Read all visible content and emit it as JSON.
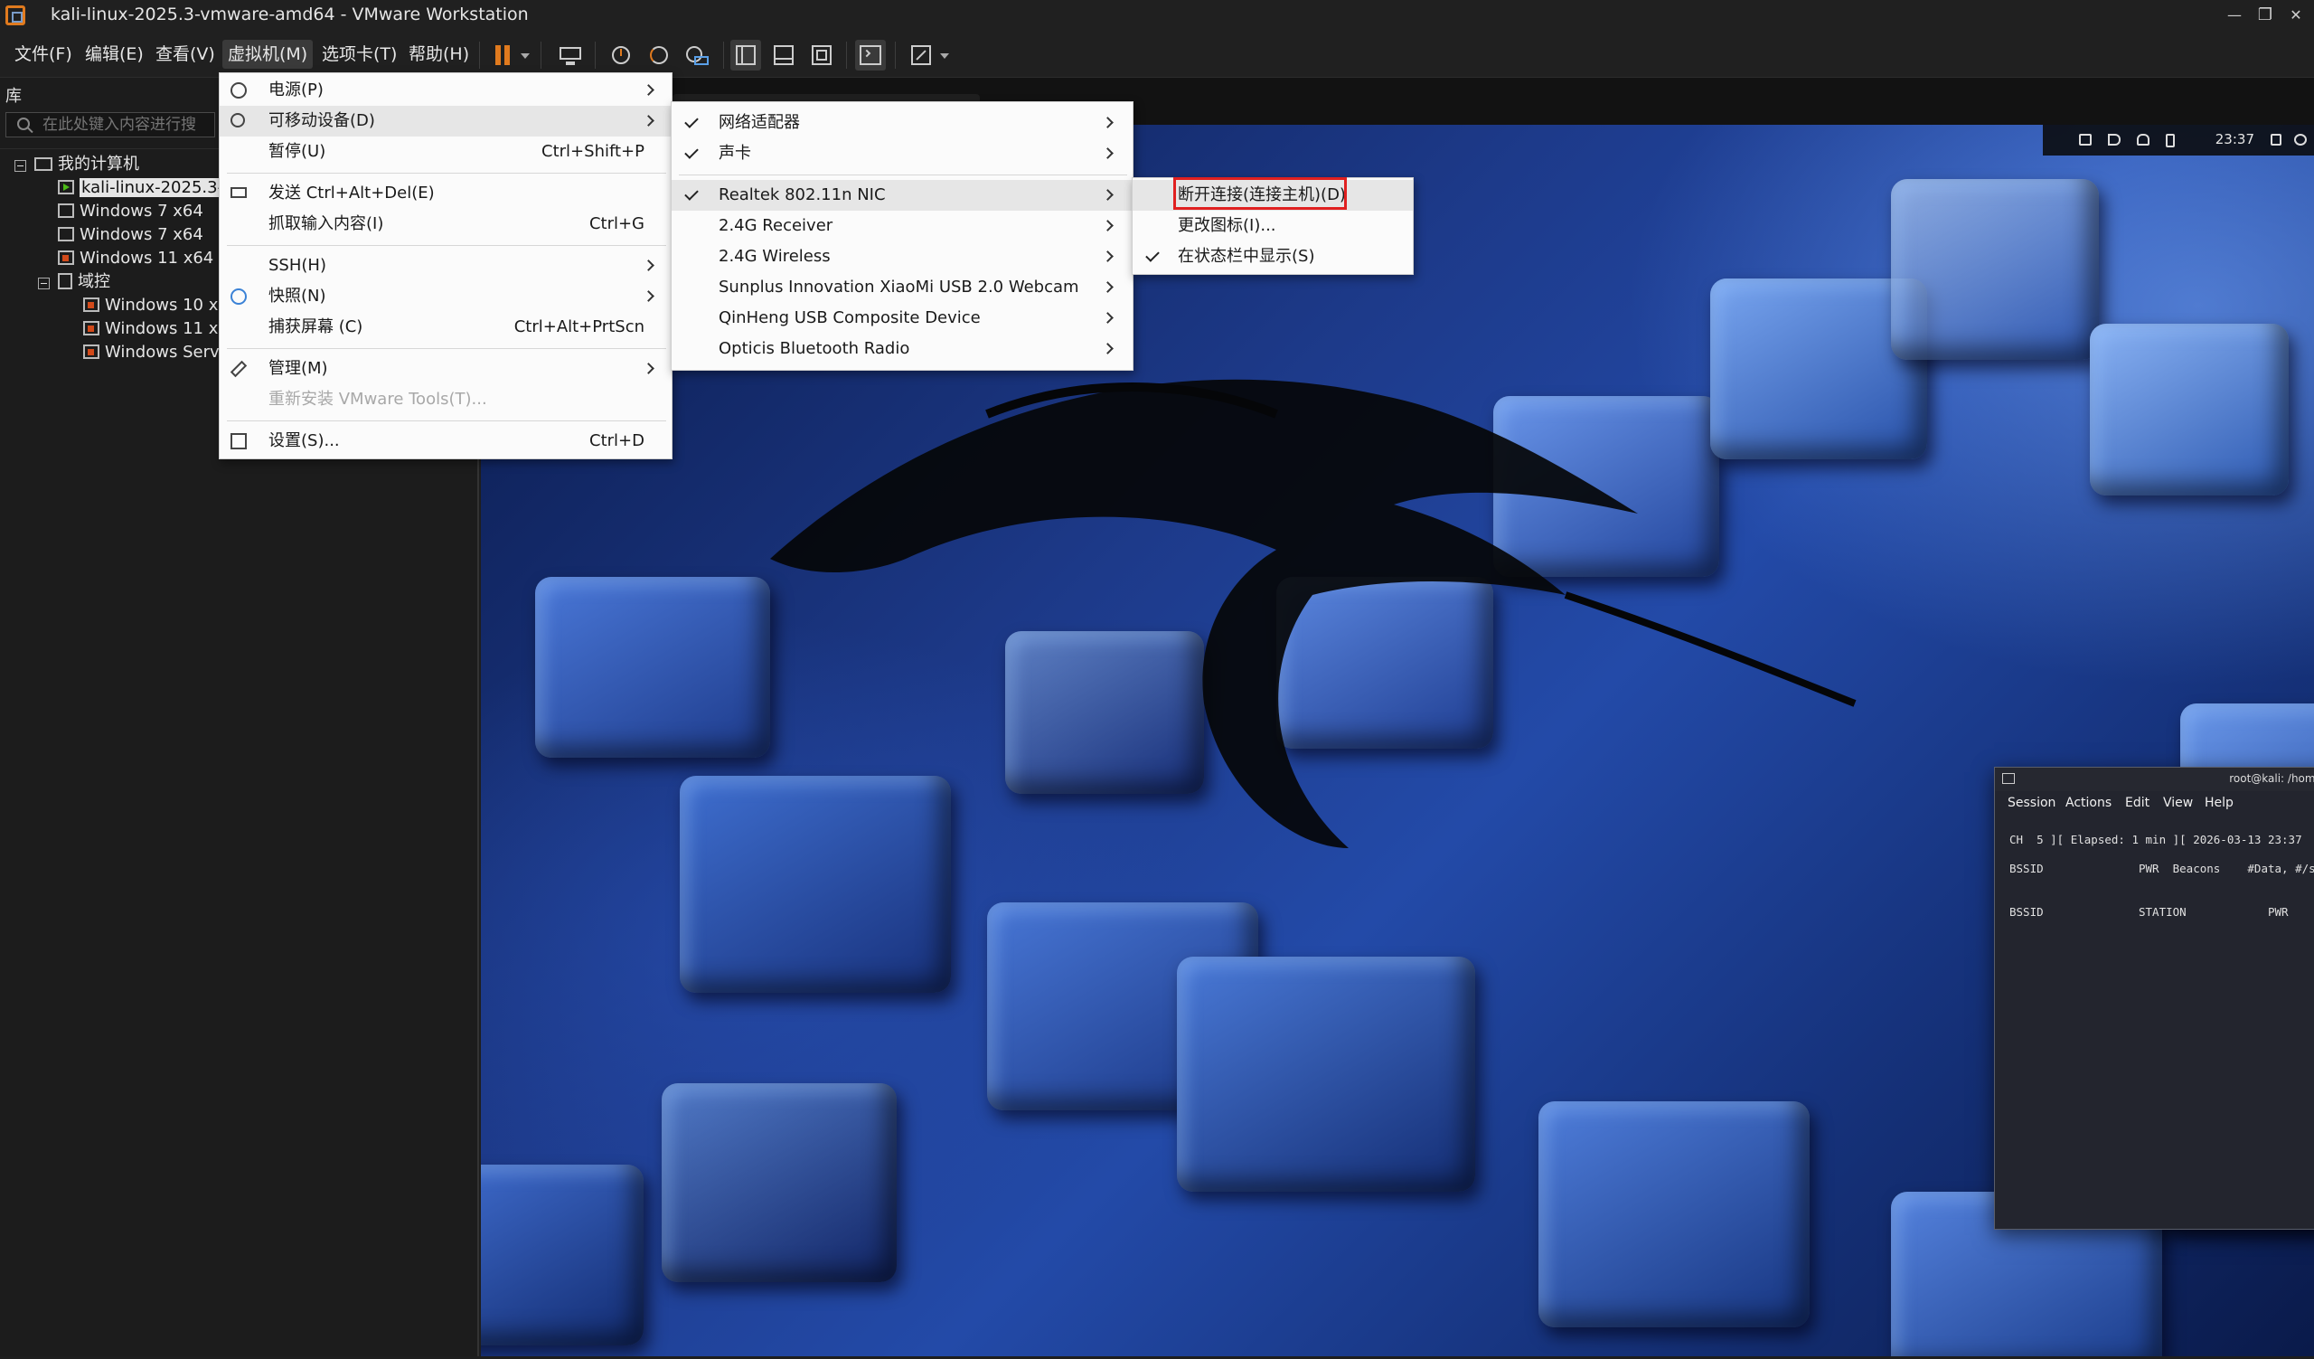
{
  "window": {
    "title": "kali-linux-2025.3-vmware-amd64 - VMware Workstation",
    "min_label": "—",
    "restore_label": "❐",
    "close_label": "✕"
  },
  "menubar": {
    "items": [
      {
        "label": "文件(F)"
      },
      {
        "label": "编辑(E)"
      },
      {
        "label": "查看(V)"
      },
      {
        "label": "虚拟机(M)"
      },
      {
        "label": "选项卡(T)"
      },
      {
        "label": "帮助(H)"
      }
    ]
  },
  "toolbar": {
    "icons": [
      "pause-icon",
      "dropdown-icon",
      "send-ctrl-alt-del-icon",
      "snapshot-icon",
      "revert-snapshot-icon",
      "snapshot-manager-icon",
      "show-library-icon",
      "thumbnail-bar-icon",
      "fullscreen-icon",
      "console-view-icon",
      "stretch-icon",
      "stretch-dropdown-icon"
    ],
    "accent": "#e07a1e"
  },
  "library": {
    "title": "库",
    "search_placeholder": "在此处键入内容进行搜",
    "tree": [
      {
        "label": "我的计算机",
        "type": "computer"
      },
      {
        "label": "kali-linux-2025.3-",
        "type": "vm-running",
        "selected": true
      },
      {
        "label": "Windows 7 x64",
        "type": "vm"
      },
      {
        "label": "Windows 7 x64",
        "type": "vm"
      },
      {
        "label": "Windows 11 x64",
        "type": "vm-locked"
      },
      {
        "label": "域控",
        "type": "folder"
      },
      {
        "label": "Windows 10 x",
        "type": "vm-locked"
      },
      {
        "label": "Windows 11 x",
        "type": "vm-locked"
      },
      {
        "label": "Windows Serv",
        "type": "vm-locked"
      }
    ]
  },
  "vm_menu": {
    "items": [
      {
        "label": "电源(P)",
        "icon": "power-icon",
        "submenu": true
      },
      {
        "label": "可移动设备(D)",
        "icon": "removable-device-icon",
        "submenu": true,
        "highlighted": true
      },
      {
        "label": "暂停(U)",
        "shortcut": "Ctrl+Shift+P"
      },
      {
        "label": "发送 Ctrl+Alt+Del(E)",
        "icon": "keyboard-icon"
      },
      {
        "label": "抓取输入内容(I)",
        "shortcut": "Ctrl+G"
      },
      {
        "label": "SSH(H)",
        "submenu": true
      },
      {
        "label": "快照(N)",
        "icon": "snapshot-icon",
        "submenu": true
      },
      {
        "label": "捕获屏幕 (C)",
        "shortcut": "Ctrl+Alt+PrtScn"
      },
      {
        "label": "管理(M)",
        "icon": "wrench-icon",
        "submenu": true
      },
      {
        "label": "重新安装 VMware Tools(T)...",
        "disabled": true
      },
      {
        "label": "设置(S)...",
        "icon": "settings-icon",
        "shortcut": "Ctrl+D"
      }
    ]
  },
  "removable_menu": {
    "items": [
      {
        "label": "网络适配器",
        "checked": true,
        "submenu": true
      },
      {
        "label": "声卡",
        "checked": true,
        "submenu": true
      },
      {
        "label": "Realtek 802.11n NIC",
        "checked": true,
        "submenu": true,
        "highlighted": true
      },
      {
        "label": "2.4G Receiver",
        "submenu": true
      },
      {
        "label": "2.4G Wireless",
        "submenu": true
      },
      {
        "label": "Sunplus Innovation XiaoMi USB 2.0 Webcam",
        "submenu": true
      },
      {
        "label": "QinHeng USB Composite Device",
        "submenu": true
      },
      {
        "label": "Opticis Bluetooth Radio",
        "submenu": true
      }
    ]
  },
  "device_menu": {
    "items": [
      {
        "label": "断开连接(连接主机)(D)",
        "highlighted": true,
        "annotated": true
      },
      {
        "label": "更改图标(I)..."
      },
      {
        "label": "在状态栏中显示(S)",
        "checked": true
      }
    ],
    "annotation_color": "#e02020"
  },
  "kali": {
    "clock": "23:37",
    "tray_icons": [
      "display-icon",
      "volume-icon",
      "notification-icon",
      "battery-icon",
      "lock-icon",
      "power-icon"
    ]
  },
  "terminal": {
    "title": "root@kali: /home/kali",
    "menus": [
      "Session",
      "Actions",
      "Edit",
      "View",
      "Help"
    ],
    "close_glyph": "✕",
    "lines": [
      "CH  5 ][ Elapsed: 1 min ][ 2026-03-13 23:37",
      "BSSID              PWR  Beacons    #Data, #/s  CH   MB   ENC CIPHER  AUTH E",
      "BSSID              STATION            PWR    Rate    Lost    Frames  Notes"
    ]
  }
}
